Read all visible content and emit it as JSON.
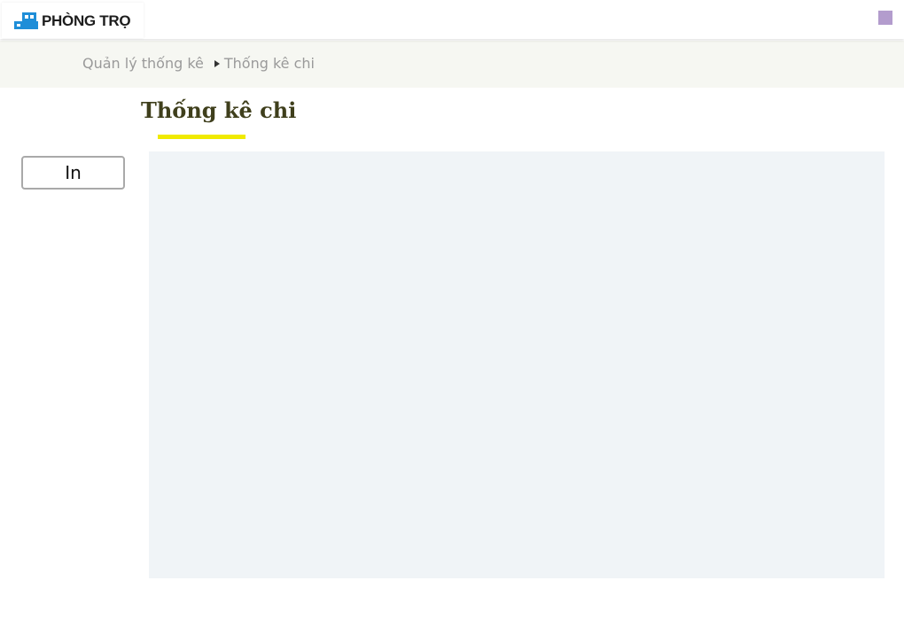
{
  "header": {
    "logo_text": "PHÒNG TRỌ",
    "logo_icon": "building-icon",
    "corner_icon": "square-icon"
  },
  "breadcrumb": {
    "parent": "Quản lý thống kê",
    "current": "Thống kê chi"
  },
  "page": {
    "title": "Thống kê chi",
    "accent_color": "#f0ea00"
  },
  "actions": {
    "print_label": "In"
  },
  "colors": {
    "title": "#3f3f1c",
    "breadcrumb_bg": "#f6f7f2",
    "panel_bg": "#f0f4f7",
    "corner_square": "#b39ccd",
    "logo_blue": "#1f8ed8"
  }
}
